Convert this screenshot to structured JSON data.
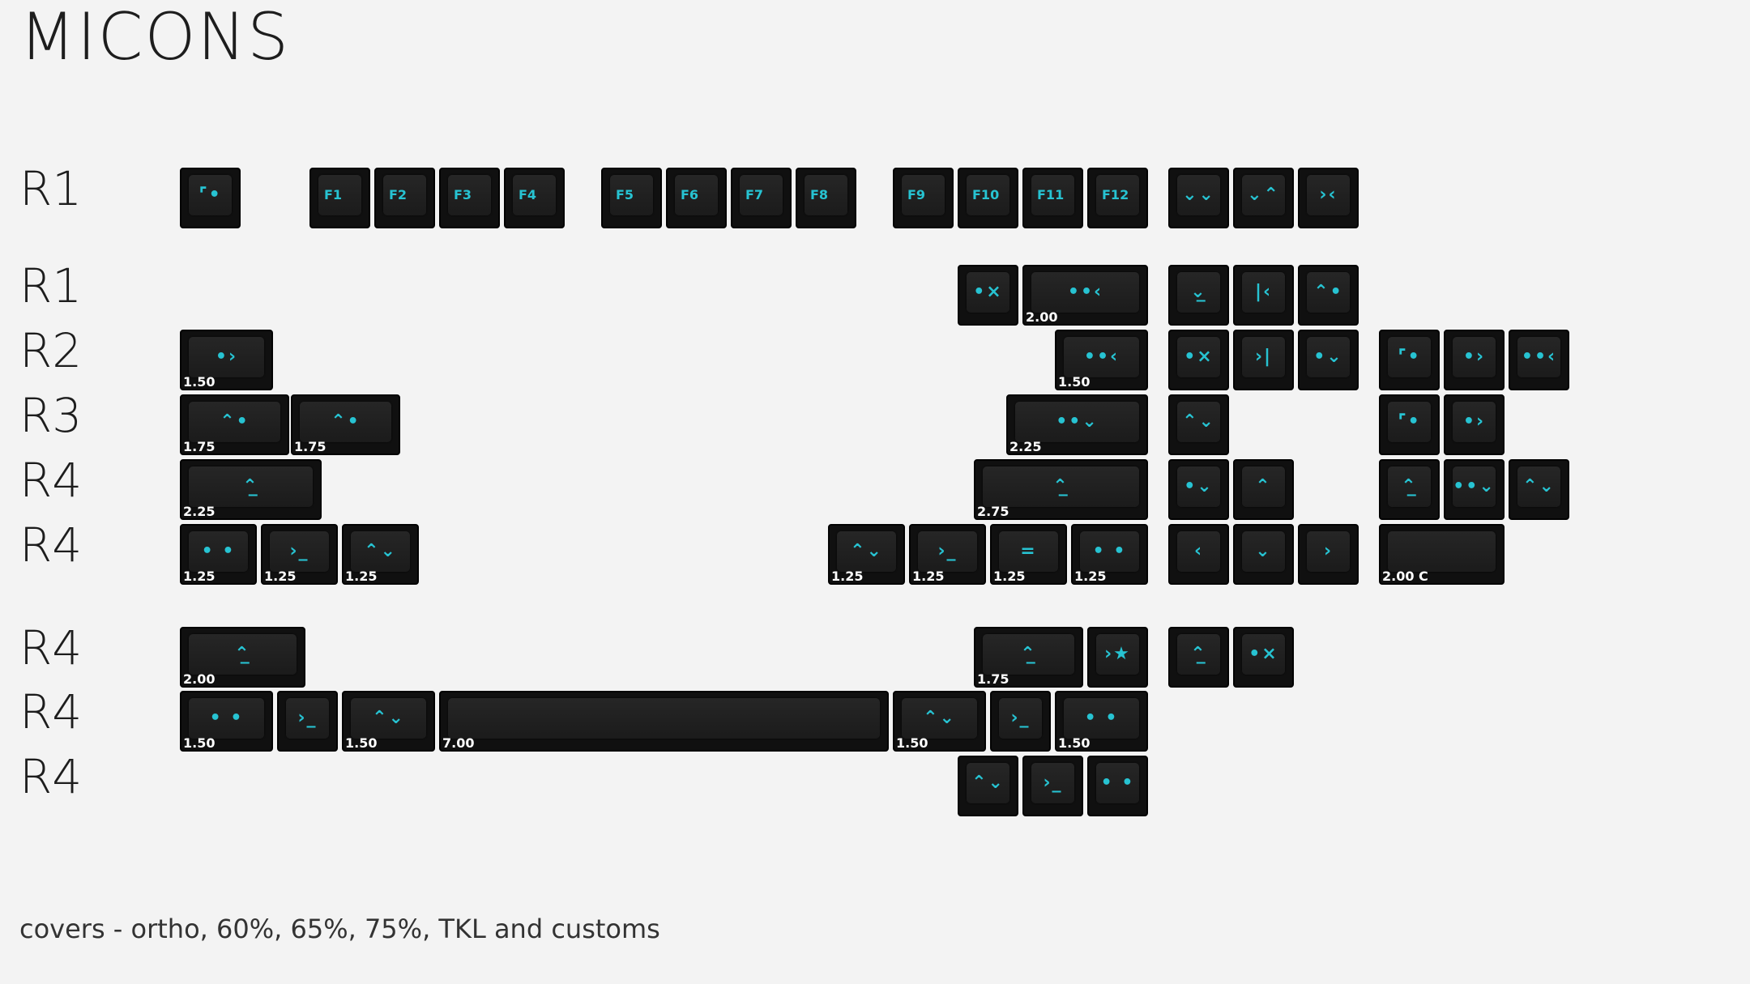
{
  "title": "MICONS",
  "caption": "covers - ortho, 60%, 65%, 75%, TKL and customs",
  "accent_color": "#27c3d2",
  "keycap_color": "#1b1b1b",
  "row_labels": [
    "R1",
    "R1",
    "R2",
    "R3",
    "R4",
    "R4",
    "R4",
    "R4",
    "R4"
  ],
  "function_keys": [
    "F1",
    "F2",
    "F3",
    "F4",
    "F5",
    "F6",
    "F7",
    "F8",
    "F9",
    "F10",
    "F11",
    "F12"
  ],
  "icons": {
    "corner_dot": "⌜•",
    "dot_chevron_right": "•›",
    "dot_x": "•×",
    "dots_chevron_left": "••‹",
    "chevrons_down": "⌄⌄",
    "chevrons_pinch": "⌄⌃",
    "chevrons_in": "›‹",
    "underline_down": "⌄̲",
    "bar_left": "|‹",
    "bar_right": "›|",
    "chevron_up_dot": "⌃•",
    "dot_chevron_down": "•⌄",
    "face_dot": "⌃•",
    "dots_chevron_down": "••⌄",
    "caret_underline": "⌃̲",
    "dots_double": "• •",
    "prompt": "›_",
    "chevrons_up_down": "⌃⌄",
    "equals": "=",
    "chevron_up": "⌃",
    "chevron_down": "⌄",
    "chevron_left": "‹",
    "chevron_right": "›",
    "chevron_star": "›★",
    "up_down_dot": "⌃⌄"
  },
  "sizes": {
    "s125": "1.25",
    "s150": "1.50",
    "s175": "1.75",
    "s200": "2.00",
    "s225": "2.25",
    "s275": "2.75",
    "s700": "7.00",
    "s200c": "2.00 C"
  }
}
